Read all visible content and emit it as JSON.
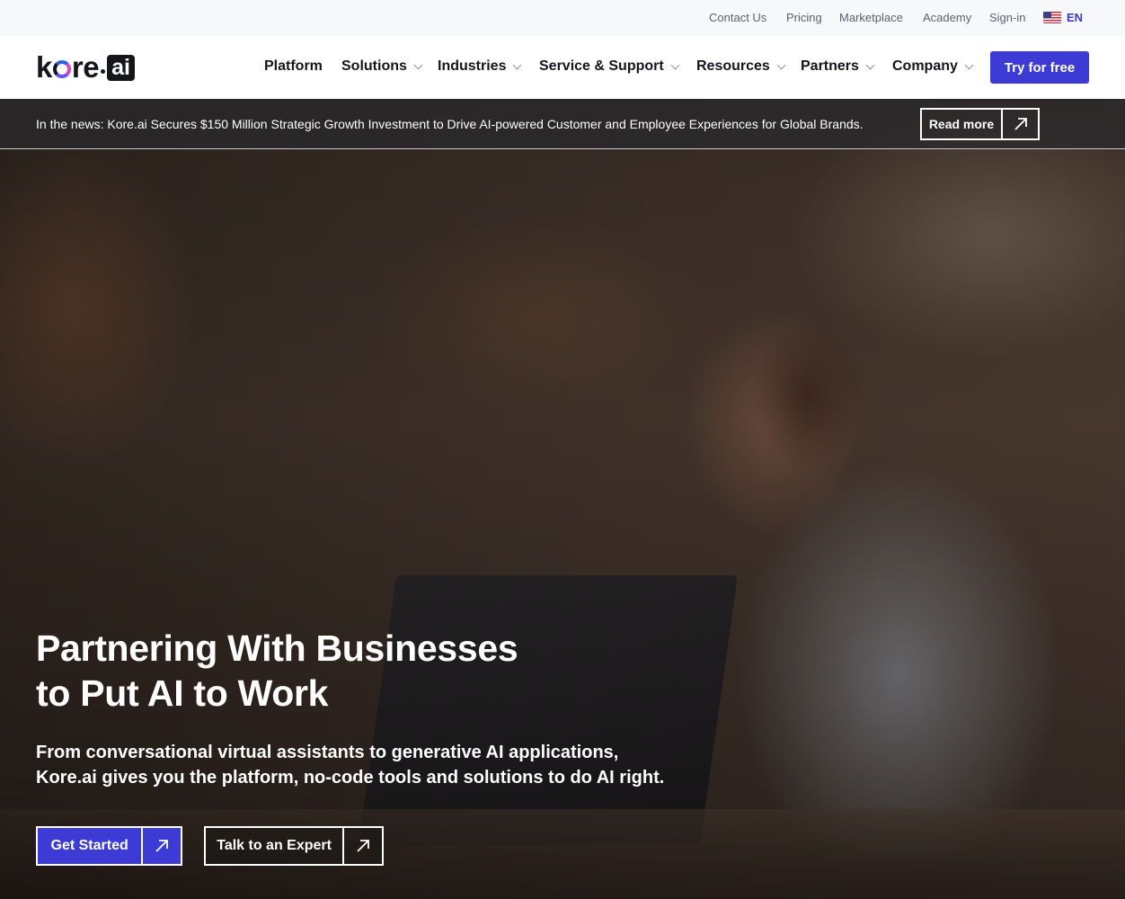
{
  "utility_nav": {
    "links": [
      "Contact Us",
      "Pricing",
      "Marketplace",
      "Academy",
      "Sign-in"
    ],
    "language": "EN"
  },
  "brand": {
    "logo_text_1": "k",
    "logo_text_2": "re",
    "logo_ai": "ai"
  },
  "main_nav": {
    "items": [
      "Platform",
      "Solutions",
      "Industries",
      "Service & Support",
      "Resources",
      "Partners",
      "Company"
    ],
    "cta": "Try for free"
  },
  "news_bar": {
    "text": "In the news: Kore.ai Secures $150 Million Strategic Growth Investment to Drive AI-powered Customer and Employee Experiences for Global Brands.",
    "button": "Read more"
  },
  "hero": {
    "title_line_1": "Partnering With Businesses",
    "title_line_2": "to Put AI to Work",
    "subtitle_line_1": "From conversational virtual assistants to generative AI applications,",
    "subtitle_line_2": "Kore.ai gives you the platform, no-code tools and solutions to do AI right.",
    "primary_cta": "Get Started",
    "secondary_cta": "Talk to an Expert"
  },
  "colors": {
    "accent": "#3c3bd6",
    "text_dark": "#15161c",
    "util_bg": "#f7f8fa"
  }
}
